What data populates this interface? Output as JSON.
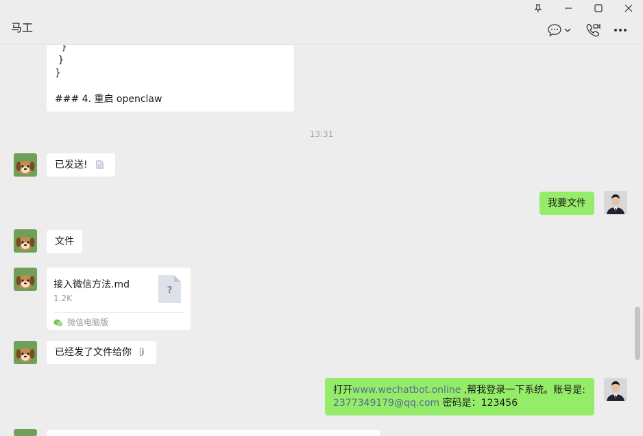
{
  "window": {
    "title": "马工",
    "controls": [
      "pin-icon",
      "minimize-icon",
      "maximize-icon",
      "close-icon"
    ]
  },
  "header_actions": [
    "chat-bubble-icon",
    "chevron-down-icon",
    "video-call-icon",
    "more-icon"
  ],
  "messages": {
    "code_tail": {
      "line1": "  }",
      "line2": " }",
      "line3": "}",
      "line4": "### 4. 重启 openclaw"
    },
    "time": "13:31",
    "sent_notice": "已发送!",
    "request_file": "我要文件",
    "file_word": "文件",
    "file_card": {
      "name": "接入微信方法.md",
      "size": "1.2K",
      "source": "微信电脑版",
      "icon_glyph": "?"
    },
    "file_sent": "已经发了文件给你",
    "login_request": {
      "prefix": "打开",
      "url": "www.wechatbot.online",
      "middle": " ,帮我登录一下系统。账号是:",
      "email": "2377349179@qq.com",
      "suffix": " 密码是：123456"
    }
  },
  "colors": {
    "background": "#ededed",
    "incoming_bubble": "#ffffff",
    "outgoing_bubble": "#95ec69",
    "link": "#576b95"
  }
}
